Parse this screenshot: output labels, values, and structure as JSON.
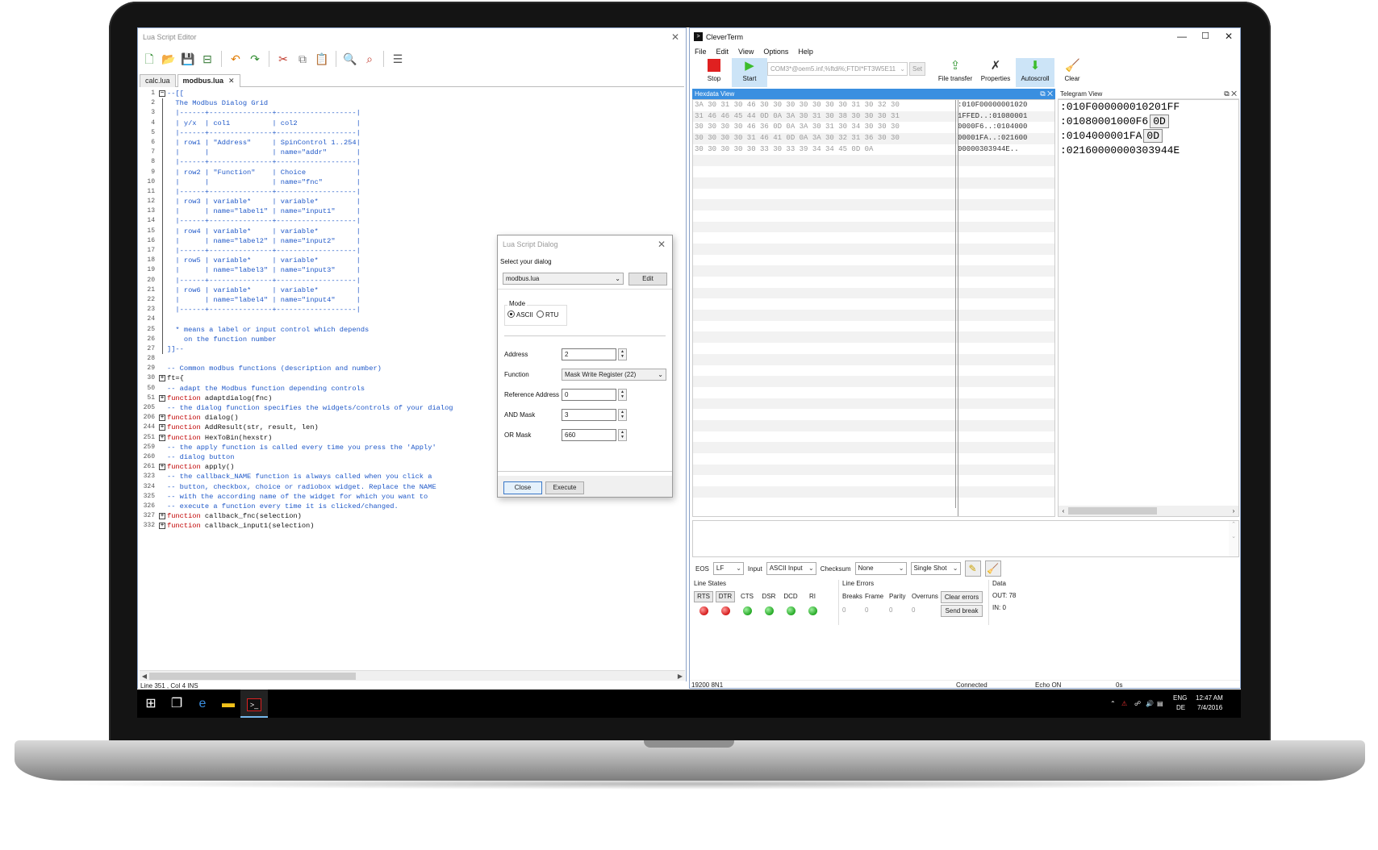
{
  "editor": {
    "title": "Lua Script Editor",
    "tabs": [
      {
        "label": "calc.lua",
        "active": false
      },
      {
        "label": "modbus.lua",
        "active": true
      }
    ],
    "lines": [
      {
        "n": "1",
        "fold": "minus",
        "segs": [
          {
            "c": "cmt",
            "t": "--[["
          }
        ]
      },
      {
        "n": "2",
        "segs": [
          {
            "c": "cmt",
            "t": "  The Modbus Dialog Grid"
          }
        ]
      },
      {
        "n": "3",
        "segs": [
          {
            "c": "cmt",
            "t": "  |------+---------------+-------------------|"
          }
        ]
      },
      {
        "n": "4",
        "segs": [
          {
            "c": "cmt",
            "t": "  | y/x  | col1          | col2              |"
          }
        ]
      },
      {
        "n": "5",
        "segs": [
          {
            "c": "cmt",
            "t": "  |------+---------------+-------------------|"
          }
        ]
      },
      {
        "n": "6",
        "segs": [
          {
            "c": "cmt",
            "t": "  | row1 | \"Address\"     | SpinControl 1..254|"
          }
        ]
      },
      {
        "n": "7",
        "segs": [
          {
            "c": "cmt",
            "t": "  |      |               | name=\"addr\"       |"
          }
        ]
      },
      {
        "n": "8",
        "segs": [
          {
            "c": "cmt",
            "t": "  |------+---------------+-------------------|"
          }
        ]
      },
      {
        "n": "9",
        "segs": [
          {
            "c": "cmt",
            "t": "  | row2 | \"Function\"    | Choice            |"
          }
        ]
      },
      {
        "n": "10",
        "segs": [
          {
            "c": "cmt",
            "t": "  |      |               | name=\"fnc\"        |"
          }
        ]
      },
      {
        "n": "11",
        "segs": [
          {
            "c": "cmt",
            "t": "  |------+---------------+-------------------|"
          }
        ]
      },
      {
        "n": "12",
        "segs": [
          {
            "c": "cmt",
            "t": "  | row3 | variable*     | variable*         |"
          }
        ]
      },
      {
        "n": "13",
        "segs": [
          {
            "c": "cmt",
            "t": "  |      | name=\"label1\" | name=\"input1\"     |"
          }
        ]
      },
      {
        "n": "14",
        "segs": [
          {
            "c": "cmt",
            "t": "  |------+---------------+-------------------|"
          }
        ]
      },
      {
        "n": "15",
        "segs": [
          {
            "c": "cmt",
            "t": "  | row4 | variable*     | variable*         |"
          }
        ]
      },
      {
        "n": "16",
        "segs": [
          {
            "c": "cmt",
            "t": "  |      | name=\"label2\" | name=\"input2\"     |"
          }
        ]
      },
      {
        "n": "17",
        "segs": [
          {
            "c": "cmt",
            "t": "  |------+---------------+-------------------|"
          }
        ]
      },
      {
        "n": "18",
        "segs": [
          {
            "c": "cmt",
            "t": "  | row5 | variable*     | variable*         |"
          }
        ]
      },
      {
        "n": "19",
        "segs": [
          {
            "c": "cmt",
            "t": "  |      | name=\"label3\" | name=\"input3\"     |"
          }
        ]
      },
      {
        "n": "20",
        "segs": [
          {
            "c": "cmt",
            "t": "  |------+---------------+-------------------|"
          }
        ]
      },
      {
        "n": "21",
        "segs": [
          {
            "c": "cmt",
            "t": "  | row6 | variable*     | variable*         |"
          }
        ]
      },
      {
        "n": "22",
        "segs": [
          {
            "c": "cmt",
            "t": "  |      | name=\"label4\" | name=\"input4\"     |"
          }
        ]
      },
      {
        "n": "23",
        "segs": [
          {
            "c": "cmt",
            "t": "  |------+---------------+-------------------|"
          }
        ]
      },
      {
        "n": "24",
        "segs": [
          {
            "c": "cmt",
            "t": ""
          }
        ]
      },
      {
        "n": "25",
        "segs": [
          {
            "c": "cmt",
            "t": "  * means a label or input control which depends"
          }
        ]
      },
      {
        "n": "26",
        "segs": [
          {
            "c": "cmt",
            "t": "    on the function number"
          }
        ]
      },
      {
        "n": "27",
        "segs": [
          {
            "c": "cmt",
            "t": "]]--"
          }
        ]
      },
      {
        "n": "28",
        "segs": [
          {
            "c": "def",
            "t": ""
          }
        ]
      },
      {
        "n": "29",
        "segs": [
          {
            "c": "cmt",
            "t": "-- Common modbus functions (description and number)"
          }
        ]
      },
      {
        "n": "30",
        "fold": "plus",
        "segs": [
          {
            "c": "def",
            "t": "ft={"
          }
        ]
      },
      {
        "n": "50",
        "segs": [
          {
            "c": "cmt",
            "t": "-- adapt the Modbus function depending controls"
          }
        ]
      },
      {
        "n": "51",
        "fold": "plus",
        "segs": [
          {
            "c": "kw",
            "t": "function"
          },
          {
            "c": "def",
            "t": " adaptdialog(fnc)"
          }
        ]
      },
      {
        "n": "205",
        "segs": [
          {
            "c": "cmt",
            "t": "-- the dialog function specifies the widgets/controls of your dialog"
          }
        ]
      },
      {
        "n": "206",
        "fold": "plus",
        "segs": [
          {
            "c": "kw",
            "t": "function"
          },
          {
            "c": "def",
            "t": " dialog()"
          }
        ]
      },
      {
        "n": "244",
        "fold": "plus",
        "segs": [
          {
            "c": "kw",
            "t": "function"
          },
          {
            "c": "def",
            "t": " AddResult(str, result, len)"
          }
        ]
      },
      {
        "n": "251",
        "fold": "plus",
        "segs": [
          {
            "c": "kw",
            "t": "function"
          },
          {
            "c": "def",
            "t": " HexToBin(hexstr)"
          }
        ]
      },
      {
        "n": "259",
        "segs": [
          {
            "c": "cmt",
            "t": "-- the apply function is called every time you press the 'Apply'"
          }
        ]
      },
      {
        "n": "260",
        "segs": [
          {
            "c": "cmt",
            "t": "-- dialog button"
          }
        ]
      },
      {
        "n": "261",
        "fold": "plus",
        "segs": [
          {
            "c": "kw",
            "t": "function"
          },
          {
            "c": "def",
            "t": " apply()"
          }
        ]
      },
      {
        "n": "323",
        "segs": [
          {
            "c": "cmt",
            "t": "-- the callback_NAME function is always called when you click a"
          }
        ]
      },
      {
        "n": "324",
        "segs": [
          {
            "c": "cmt",
            "t": "-- button, checkbox, choice or radiobox widget. Replace the NAME"
          }
        ]
      },
      {
        "n": "325",
        "segs": [
          {
            "c": "cmt",
            "t": "-- with the according name of the widget for which you want to"
          }
        ]
      },
      {
        "n": "326",
        "segs": [
          {
            "c": "cmt",
            "t": "-- execute a function every time it is clicked/changed."
          }
        ]
      },
      {
        "n": "327",
        "fold": "plus",
        "segs": [
          {
            "c": "kw",
            "t": "function"
          },
          {
            "c": "def",
            "t": " callback_fnc(selection)"
          }
        ]
      },
      {
        "n": "332",
        "fold": "plus",
        "segs": [
          {
            "c": "kw",
            "t": "function"
          },
          {
            "c": "def",
            "t": " callback_input1(selection)"
          }
        ]
      }
    ],
    "status": "Line  351 , Col 4    INS"
  },
  "clever": {
    "title": "CleverTerm",
    "menu": [
      "File",
      "Edit",
      "View",
      "Options",
      "Help"
    ],
    "tools": {
      "stop": "Stop",
      "start": "Start",
      "port": "COM3*@oem5.inf,%ftdi%;FTDI*FT3W5E11",
      "set": "Set",
      "file_transfer": "File transfer",
      "properties": "Properties",
      "autoscroll": "Autoscroll",
      "clear": "Clear"
    },
    "hex_title": "Hexdata View",
    "hex_rows": [
      {
        "hex": "3A 30 31 30 46 30 30 30 30 30 30 30 31 30 32 30",
        "ascii": ":010F00000001020"
      },
      {
        "hex": "31 46 46 45 44 0D 0A 3A 30 31 30 38 30 30 30 31",
        "ascii": "1FFED..:01080001"
      },
      {
        "hex": "30 30 30 30 46 36 0D 0A 3A 30 31 30 34 30 30 30",
        "ascii": "0000F6..:0104000"
      },
      {
        "hex": "30 30 30 30 31 46 41 0D 0A 3A 30 32 31 36 30 30",
        "ascii": "00001FA..:021600"
      },
      {
        "hex": "30 30 30 30 30 33 30 33 39 34 34 45 0D 0A",
        "ascii": "00000303944E.."
      }
    ],
    "tel_title": "Telegram View",
    "tel_rows": [
      {
        "text": ":010F000000010201FF",
        "box": ""
      },
      {
        "text": ":01080001000F6",
        "box": "0D"
      },
      {
        "text": ":0104000001FA",
        "box": "0D"
      },
      {
        "text": ":02160000000303944E",
        "box": ""
      }
    ],
    "options": {
      "eos_label": "EOS",
      "eos_value": "LF",
      "input_label": "Input",
      "input_value": "ASCII Input",
      "checksum_label": "Checksum",
      "checksum_value": "None",
      "mode_value": "Single Shot"
    },
    "line_states": {
      "title": "Line States",
      "items": [
        {
          "label": "RTS",
          "button": true,
          "led": "red"
        },
        {
          "label": "DTR",
          "button": true,
          "led": "red"
        },
        {
          "label": "CTS",
          "button": false,
          "led": "green"
        },
        {
          "label": "DSR",
          "button": false,
          "led": "green"
        },
        {
          "label": "DCD",
          "button": false,
          "led": "green"
        },
        {
          "label": "RI",
          "button": false,
          "led": "green"
        }
      ]
    },
    "line_errors": {
      "title": "Line Errors",
      "items": [
        {
          "label": "Breaks",
          "value": "0"
        },
        {
          "label": "Frame",
          "value": "0"
        },
        {
          "label": "Parity",
          "value": "0"
        },
        {
          "label": "Overruns",
          "value": "0"
        }
      ],
      "clear_btn": "Clear errors",
      "break_btn": "Send break"
    },
    "data": {
      "title": "Data",
      "out": "OUT: 78",
      "in": "IN:  0"
    },
    "status": {
      "baud": "19200 8N1",
      "conn": "Connected",
      "echo": "Echo ON",
      "time": "0s"
    }
  },
  "dialog": {
    "title": "Lua Script Dialog",
    "select_label": "Select your dialog",
    "select_value": "modbus.lua",
    "edit_btn": "Edit",
    "mode_label": "Mode",
    "mode_ascii": "ASCII",
    "mode_rtu": "RTU",
    "fields": [
      {
        "label": "Address",
        "value": "2",
        "type": "spin"
      },
      {
        "label": "Function",
        "value": "Mask Write Register (22)",
        "type": "select"
      },
      {
        "label": "Reference Address",
        "value": "0",
        "type": "spin"
      },
      {
        "label": "AND Mask",
        "value": "3",
        "type": "spin"
      },
      {
        "label": "OR Mask",
        "value": "660",
        "type": "spin"
      }
    ],
    "close_btn": "Close",
    "execute_btn": "Execute"
  },
  "taskbar": {
    "lang_top": "ENG",
    "lang_bottom": "DE",
    "time": "12:47 AM",
    "date": "7/4/2016"
  }
}
